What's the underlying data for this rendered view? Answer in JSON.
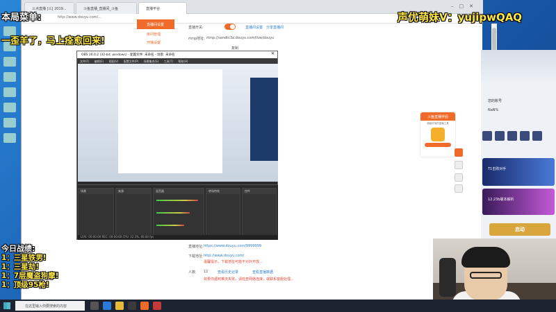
{
  "overlays": {
    "menu_title": "本局菜单:",
    "message": "一歪羊了，马上痊愈回来!",
    "wechat": "声优萌妹V：yujipwQAQ",
    "battle_title": "今日战绩:",
    "battle_items": [
      "1：三星铁男!",
      "1：三星劫!",
      "1：7层魔盗狗摩!",
      "1：顶级95枪!"
    ]
  },
  "browser": {
    "tabs": [
      "三点直播 [三] 2019...",
      "斗鱼直播_直播间_斗鱼",
      "直播平台"
    ],
    "url": "http://www.douyu.com/...",
    "sidebar_active": "直播间设置",
    "sidebar_items": [
      "房间管理",
      "开播设置"
    ],
    "stream_label": "直播开关:",
    "rtmp_label": "rtmp地址:",
    "rtmp_value": "rtmp://sendtc3a.douyu.com/live/douyu",
    "copy": "复制",
    "link1": "直播间设置",
    "link2": "分享直播间",
    "field1_label": "直播地址:",
    "field1_value": "https://www.douyu.com/9999999",
    "field2_label": "下载地址:",
    "field2_value": "http://www.douyu.com/",
    "field2_note": "温馨提示，下载地址可能不对外开放...",
    "count_label": "人数:",
    "count_value": "12",
    "link3": "查看历史记录",
    "link4": "查看直播数据",
    "warning": "如果你遇到推流失败，请检查网络连接，或联系客服处理..."
  },
  "obs": {
    "title": "OBS 26.0.2 (32-bit, windows) - 配置文件: 未命名 - 场景: 未命名",
    "menu": "文件(F) 编辑(E) 视图(V) 配置文件(P) 场景集合(S) 工具(T) 帮助(H)",
    "dock_scenes": "场景",
    "dock_sources": "来源",
    "dock_mixer": "混音器",
    "dock_transitions": "转场特效",
    "dock_controls": "控件",
    "status": "LIVE: 00:00:00   REC: 00:00:00   CPU: 12.3%, 60.00 fps"
  },
  "promo": {
    "title": "斗鱼直播伴侣",
    "subtitle": "超级好用的直播工具"
  },
  "right_panel": {
    "user": "您的账号",
    "region": "NaN%",
    "card1": "T1击败对手",
    "card2": "12.23b版本解析",
    "start": "启动"
  },
  "taskbar": {
    "search_placeholder": "在这里输入你要搜索的内容"
  }
}
